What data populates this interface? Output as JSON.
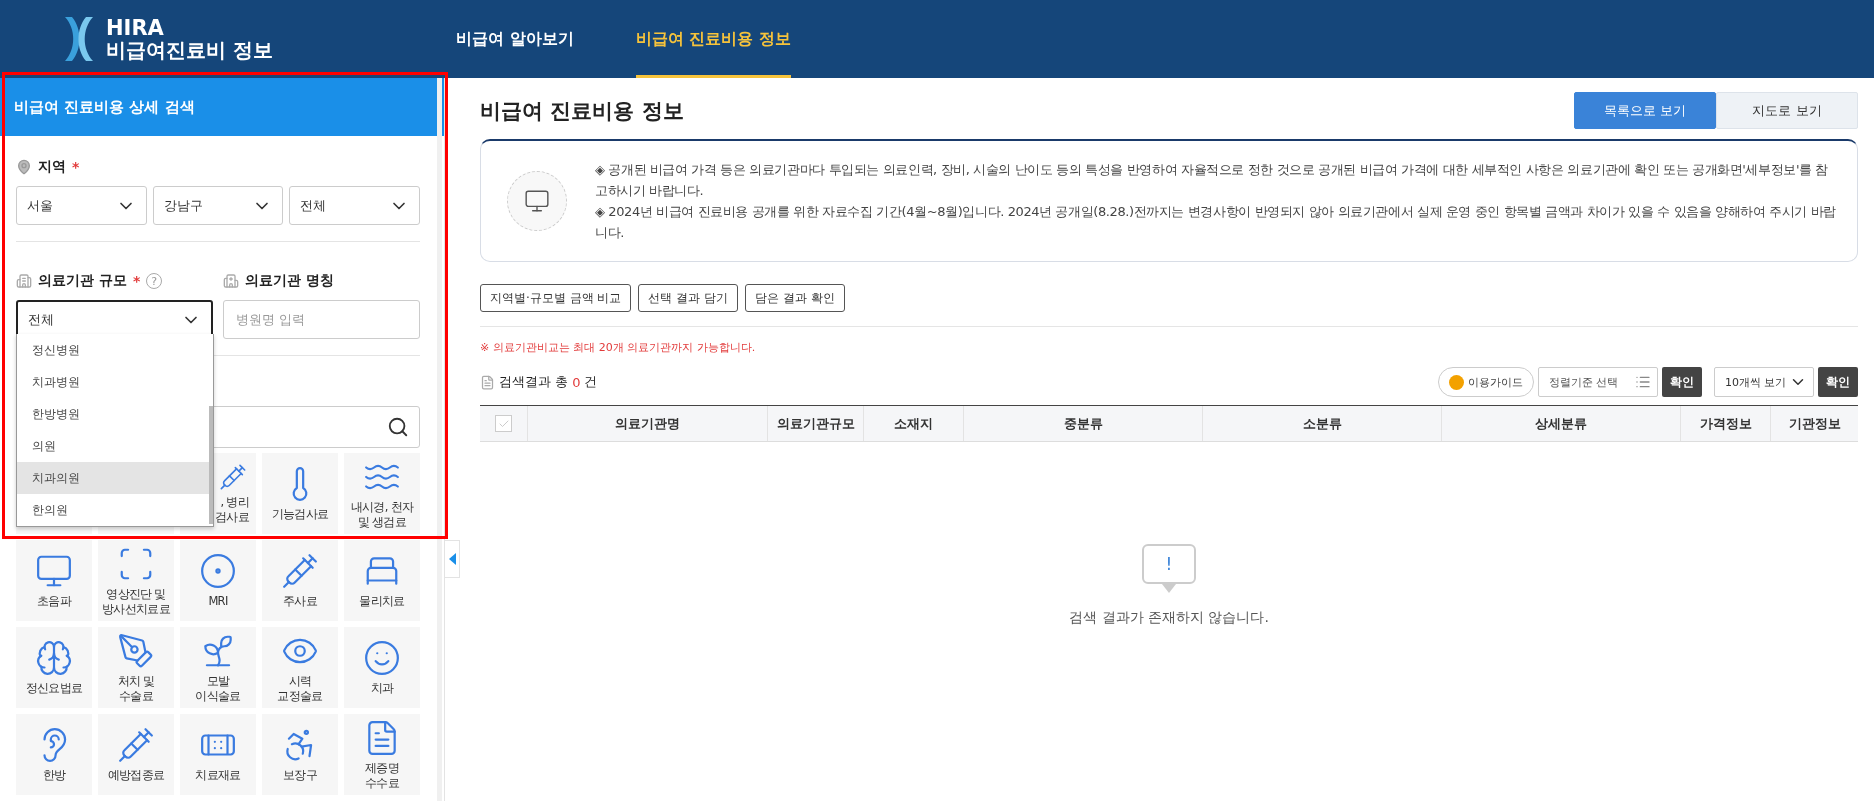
{
  "header": {
    "logo_title": "HIRA",
    "logo_subtitle": "비급여진료비 정보",
    "nav": [
      {
        "label": "비급여 알아보기",
        "selected": false
      },
      {
        "label": "비급여 진료비용 정보",
        "selected": true
      }
    ]
  },
  "search_panel": {
    "title": "비급여 진료비용 상세 검색",
    "region": {
      "label": "지역",
      "required_mark": "*",
      "selects": [
        "서울",
        "강남구",
        "전체"
      ]
    },
    "scale": {
      "label": "의료기관 규모",
      "required_mark": "*",
      "help": "?",
      "value": "전체",
      "options": [
        {
          "label": "정신병원",
          "selected": false
        },
        {
          "label": "치과병원",
          "selected": false
        },
        {
          "label": "한방병원",
          "selected": false
        },
        {
          "label": "의원",
          "selected": false
        },
        {
          "label": "치과의원",
          "selected": true
        },
        {
          "label": "한의원",
          "selected": false
        }
      ]
    },
    "name": {
      "label": "의료기관 명칭",
      "placeholder": "병원명 입력"
    },
    "categories_row_1": [
      ", 병리 검사료",
      "기능검사료",
      "내시경, 천자 및 생검료"
    ],
    "categories": [
      "초음파",
      "영상진단 및 방사선치료료",
      "MRI",
      "주사료",
      "물리치료",
      "정신요법료",
      "처치 및 수술료",
      "모발 이식술료",
      "시력 교정술료",
      "치과",
      "한방",
      "예방접종료",
      "치료재료",
      "보장구",
      "제증명 수수료"
    ]
  },
  "main": {
    "title": "비급여 진료비용 정보",
    "view_buttons": [
      {
        "label": "목록으로 보기",
        "selected": true
      },
      {
        "label": "지도로 보기",
        "selected": false
      }
    ],
    "notices": [
      "◈ 공개된 비급여 가격 등은 의료기관마다 투입되는 의료인력, 장비, 시술의 난이도 등의 특성을 반영하여 자율적으로 정한 것으로 공개된 비급여 가격에 대한 세부적인 사항은 의료기관에 확인 또는 공개화면'세부정보'를 참고하시기 바랍니다.",
      "◈ 2024년 비급여 진료비용 공개를 위한 자료수집 기간(4월~8월)입니다. 2024년 공개일(8.28.)전까지는 변경사항이 반영되지 않아 의료기관에서 실제 운영 중인 항목별 금액과 차이가 있을 수 있음을 양해하여 주시기 바랍니다."
    ],
    "actions": [
      "지역별·규모별 금액 비교",
      "선택 결과 담기",
      "담은 결과 확인"
    ],
    "limit_note": "※ 의료기관비교는 최대 20개 의료기관까지 가능합니다.",
    "result_prefix": "검색결과 총",
    "result_count": "0",
    "result_suffix": "건",
    "guide": "이용가이드",
    "sort_placeholder": "정렬기준 선택",
    "confirm": "확인",
    "page_size": "10개씩 보기",
    "confirm_2": "확인",
    "select_all": {
      "checked": false
    },
    "columns": [
      "의료기관명",
      "의료기관규모",
      "소재지",
      "중분류",
      "소분류",
      "상세분류",
      "가격정보",
      "기관정보"
    ],
    "empty_mark": "!",
    "empty_text": "검색 결과가 존재하지 않습니다."
  }
}
